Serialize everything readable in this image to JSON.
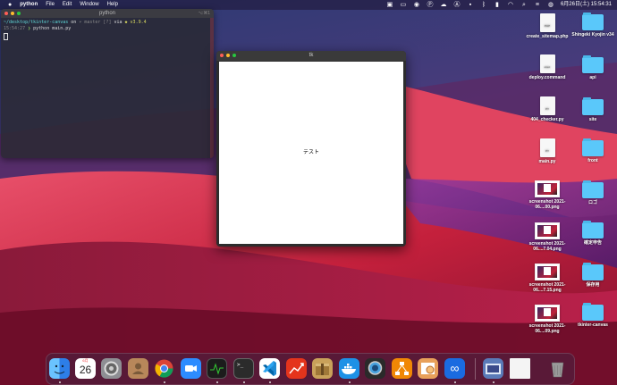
{
  "menubar": {
    "app_name": "python",
    "items": [
      "File",
      "Edit",
      "Window",
      "Help"
    ],
    "clock": "6月26日(土) 15:54:31"
  },
  "terminal": {
    "title": "python",
    "shortcut": "⌥⌘1",
    "prompt_path": "~/desktop/tkinter-canvas",
    "prompt_on": "on",
    "branch": "master",
    "branch_status": "[?]",
    "via": "via",
    "python_version": "v3.9.4",
    "time": "15:54:27",
    "command": "python main.py"
  },
  "tk_window": {
    "title": "tk",
    "label": "テスト"
  },
  "desktop": {
    "files": [
      {
        "name": "create_sitemap.php",
        "kind": "doc",
        "tag": "PHP"
      },
      {
        "name": "deploy.command",
        "kind": "doc",
        "tag": "exec"
      },
      {
        "name": "404_checker.py",
        "kind": "doc",
        "tag": "PY"
      },
      {
        "name": "main.py",
        "kind": "doc",
        "tag": "PY"
      },
      {
        "name": "screenshot 2021-06....00.png",
        "kind": "shot"
      },
      {
        "name": "screenshot 2021-06....7.04.png",
        "kind": "shot"
      },
      {
        "name": "screenshot 2021-06....7.15.png",
        "kind": "shot"
      },
      {
        "name": "screenshot 2021-06....09.png",
        "kind": "shot"
      }
    ],
    "folders": [
      {
        "name": "Shingeki Kyojin v34"
      },
      {
        "name": "api"
      },
      {
        "name": "site"
      },
      {
        "name": "front"
      },
      {
        "name": "ロゴ"
      },
      {
        "name": "確定申告"
      },
      {
        "name": "保存用"
      },
      {
        "name": "tkinter-canvas"
      }
    ]
  },
  "dock": {
    "calendar_month": "6月",
    "calendar_day": "26",
    "apps": [
      {
        "name": "finder",
        "color": "#3a8ef0"
      },
      {
        "name": "calendar",
        "color": "#ffffff"
      },
      {
        "name": "system-preferences",
        "color": "#8e8e93"
      },
      {
        "name": "contacts",
        "color": "#b8875a"
      },
      {
        "name": "chrome",
        "color": "#ffffff"
      },
      {
        "name": "zoom",
        "color": "#2d8cff"
      },
      {
        "name": "activity-monitor",
        "color": "#1c1c1c"
      },
      {
        "name": "terminal",
        "color": "#2b2b2b"
      },
      {
        "name": "vscode",
        "color": "#ffffff"
      },
      {
        "name": "instruments",
        "color": "#e4341c"
      },
      {
        "name": "archive-utility",
        "color": "#c9a15a"
      },
      {
        "name": "docker",
        "color": "#1d91e6"
      },
      {
        "name": "quicktime",
        "color": "#2a2a2a"
      },
      {
        "name": "drawio",
        "color": "#f08705"
      },
      {
        "name": "preview",
        "color": "#e8a05a"
      },
      {
        "name": "infinity",
        "color": "#1a6be0"
      },
      {
        "name": "screenshot-folder",
        "color": "#5a7ab8"
      },
      {
        "name": "document",
        "color": "#f4f4f4"
      },
      {
        "name": "trash",
        "color": "#9a9a9a"
      }
    ]
  }
}
